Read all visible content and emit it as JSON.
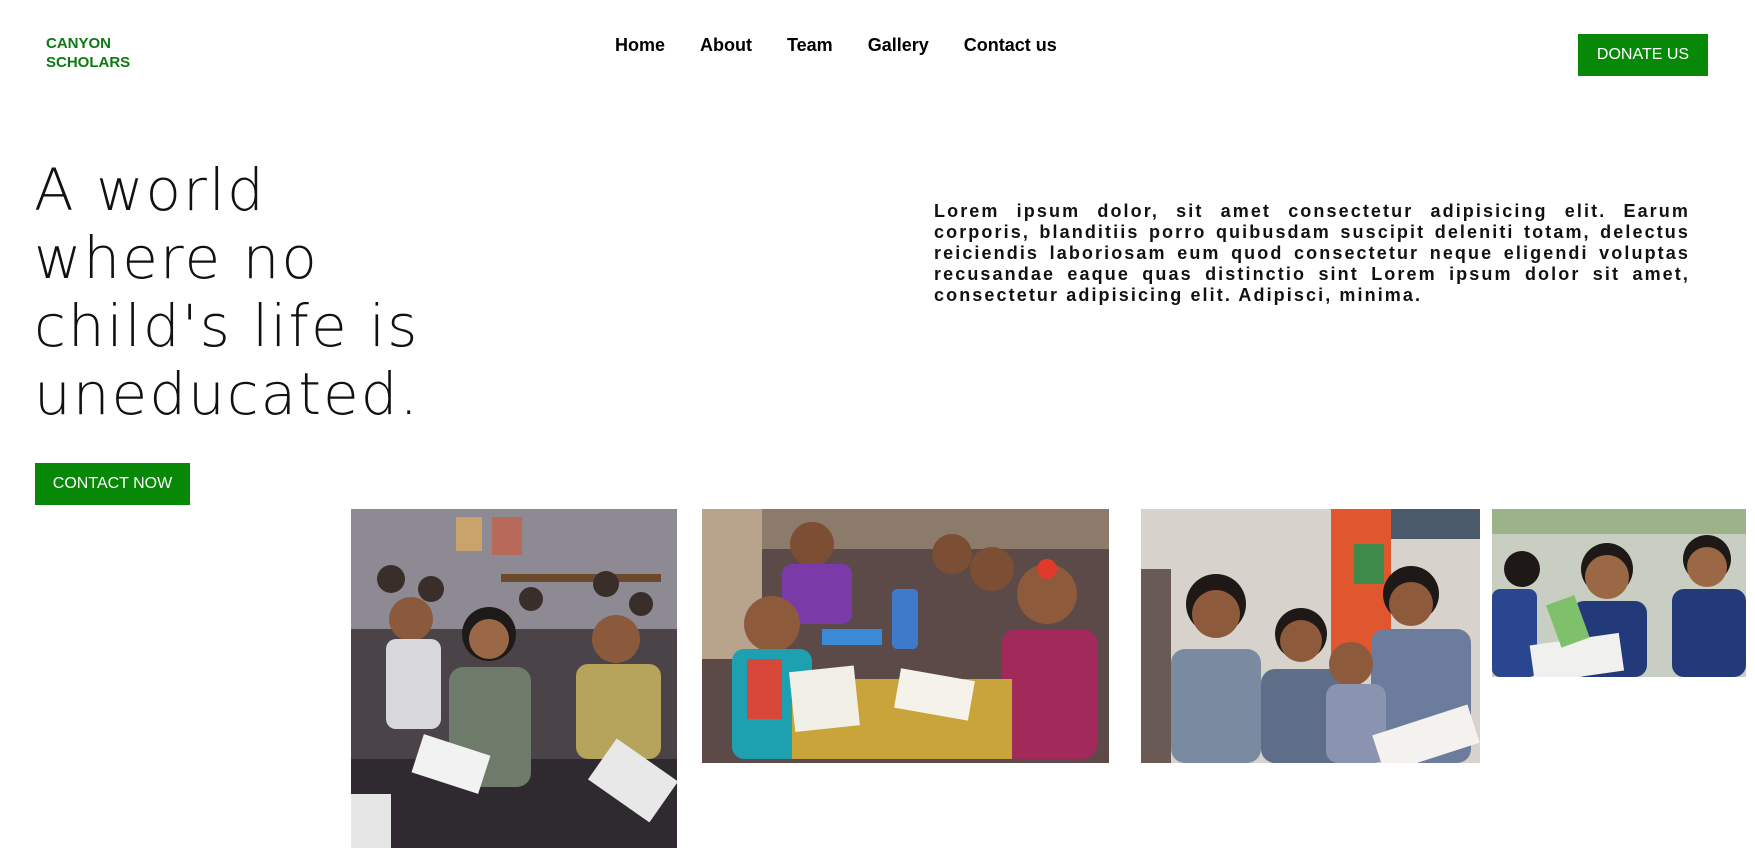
{
  "brand": {
    "line1": "CANYON",
    "line2": "SCHOLARS",
    "color": "#0b7a12"
  },
  "nav": {
    "items": [
      "Home",
      "About",
      "Team",
      "Gallery",
      "Contact us"
    ]
  },
  "donate_label": "DONATE US",
  "hero": {
    "headline": "A world where no child's life is uneducated.",
    "body": "Lorem ipsum dolor, sit amet consectetur adipisicing elit. Earum corporis, blanditiis porro quibusdam suscipit deleniti totam, delectus reiciendis laboriosam eum quod consectetur neque eligendi voluptas recusandae eaque quas distinctio sint Lorem ipsum dolor sit amet, consectetur adipisicing elit. Adipisci, minima.",
    "cta_label": "CONTACT NOW"
  },
  "colors": {
    "accent": "#078807"
  },
  "gallery": {
    "photos": [
      "children-classroom-photo",
      "children-at-table-photo",
      "children-reading-photo",
      "schoolgirls-photo"
    ]
  }
}
